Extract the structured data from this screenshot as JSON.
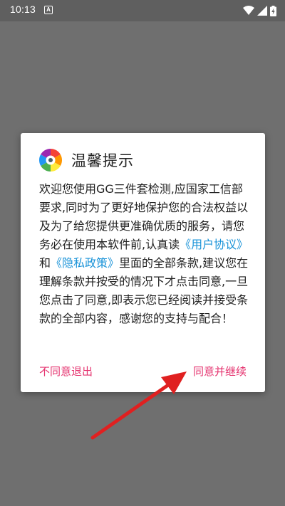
{
  "status_bar": {
    "time": "10:13",
    "app_icon_letter": "A",
    "icons": [
      "wifi-icon",
      "signal-icon",
      "battery-charging-icon"
    ]
  },
  "dialog": {
    "title": "温馨提示",
    "logo_icon": "app-logo-icon",
    "body": {
      "part1": "欢迎您使用GG三件套检测,应国家工信部要求,同时为了更好地保护您的合法权益以及为了给您提供更准确优质的服务，请您务必在使用本软件前,认真读",
      "user_agreement": "《用户协议》",
      "connector": "和",
      "privacy_policy": "《隐私政策》",
      "part2": "里面的全部条款,建议您在理解条款并按受的情况下才点击同意,一旦您点击了同意,即表示您已经阅读并接受条款的全部内容，感谢您的支持与配合！"
    },
    "decline_label": "不同意退出",
    "accept_label": "同意并继续"
  },
  "colors": {
    "overlay": "#6f6f6f",
    "status_bar": "#5f5f5f",
    "link": "#1a93d8",
    "action": "#e5336f",
    "arrow": "#e02020"
  }
}
